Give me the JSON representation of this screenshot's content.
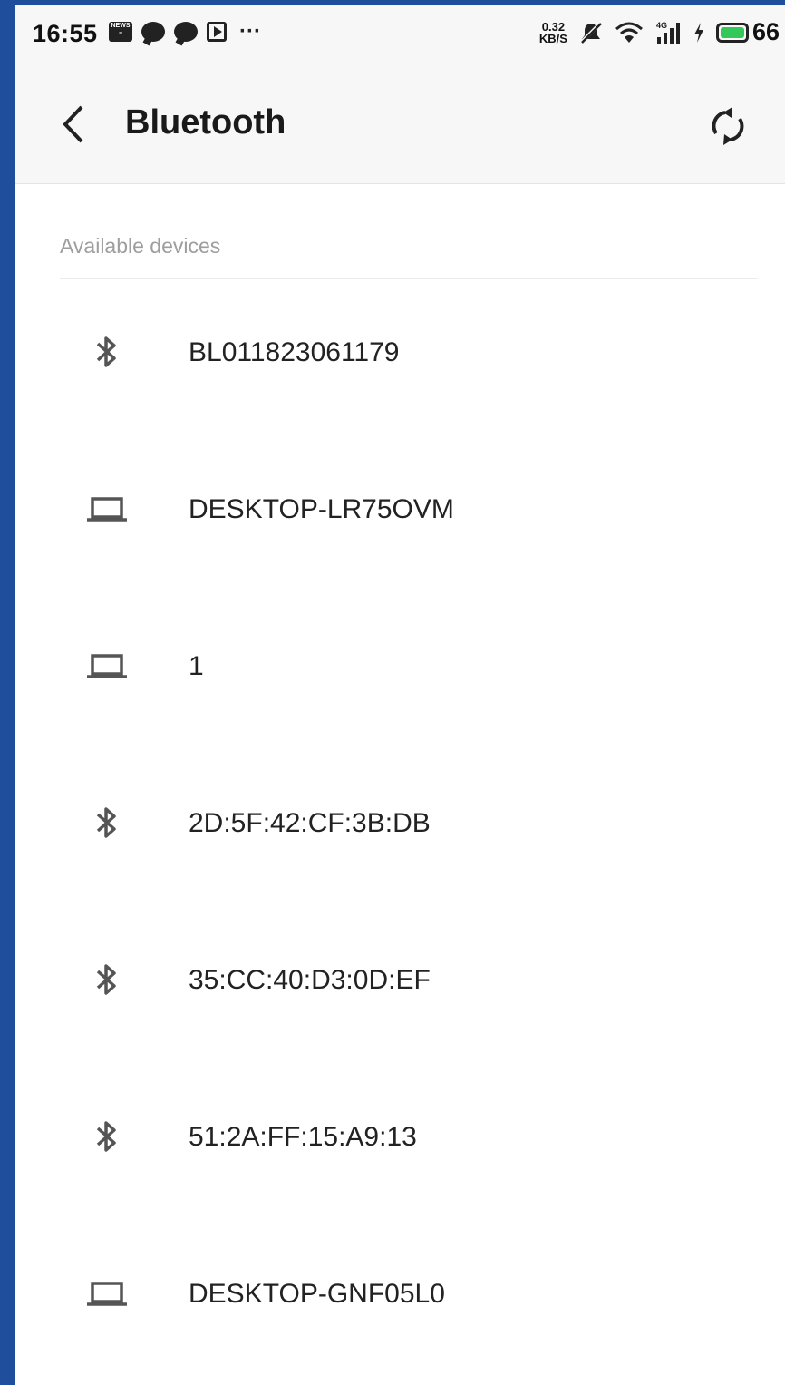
{
  "status_bar": {
    "time": "16:55",
    "speed_value": "0.32",
    "speed_unit": "KB/S",
    "network": "4G",
    "battery": "66"
  },
  "app_bar": {
    "title": "Bluetooth"
  },
  "section": {
    "label": "Available devices"
  },
  "devices": [
    {
      "name": "BL011823061179",
      "icon": "bluetooth-icon"
    },
    {
      "name": "DESKTOP-LR75OVM",
      "icon": "laptop-icon"
    },
    {
      "name": "1",
      "icon": "laptop-icon"
    },
    {
      "name": "2D:5F:42:CF:3B:DB",
      "icon": "bluetooth-icon"
    },
    {
      "name": "35:CC:40:D3:0D:EF",
      "icon": "bluetooth-icon"
    },
    {
      "name": "51:2A:FF:15:A9:13",
      "icon": "bluetooth-icon"
    },
    {
      "name": "DESKTOP-GNF05L0",
      "icon": "laptop-icon"
    }
  ],
  "colors": {
    "frame": "#1f4e9c",
    "battery_fill": "#34c759"
  }
}
